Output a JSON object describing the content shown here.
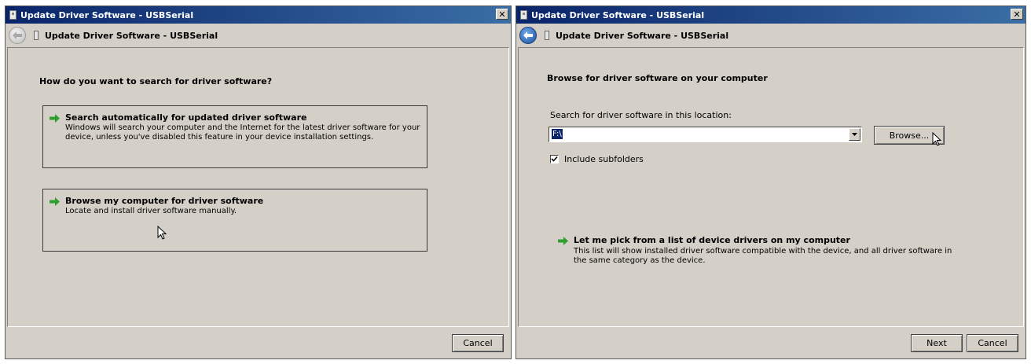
{
  "left_window": {
    "title": "Update Driver Software - USBSerial",
    "close_label": "✕",
    "nav_title": "Update Driver Software - USBSerial",
    "question": "How do you want to search for driver software?",
    "options": [
      {
        "title": "Search automatically for updated driver software",
        "description": "Windows will search your computer and the Internet for the latest driver software for your device, unless you've disabled this feature in your device installation settings."
      },
      {
        "title": "Browse my computer for driver software",
        "description": "Locate and install driver software manually."
      }
    ],
    "cancel_label": "Cancel"
  },
  "right_window": {
    "title": "Update Driver Software - USBSerial",
    "close_label": "✕",
    "nav_title": "Update Driver Software - USBSerial",
    "heading": "Browse for driver software on your computer",
    "location_label": "Search for driver software in this location:",
    "location_value": "F:\\",
    "browse_label": "Browse...",
    "include_subfolders_label": "Include subfolders",
    "include_subfolders_checked": true,
    "pick_title": "Let me pick from a list of device drivers on my computer",
    "pick_description": "This list will show installed driver software compatible with the device, and all driver software in the same category as the device.",
    "next_label": "Next",
    "cancel_label": "Cancel"
  },
  "icons": {
    "arrow_color": "#2e9e2e",
    "title_gradient_start": "#0a246a",
    "title_gradient_end": "#3a6ea5"
  }
}
